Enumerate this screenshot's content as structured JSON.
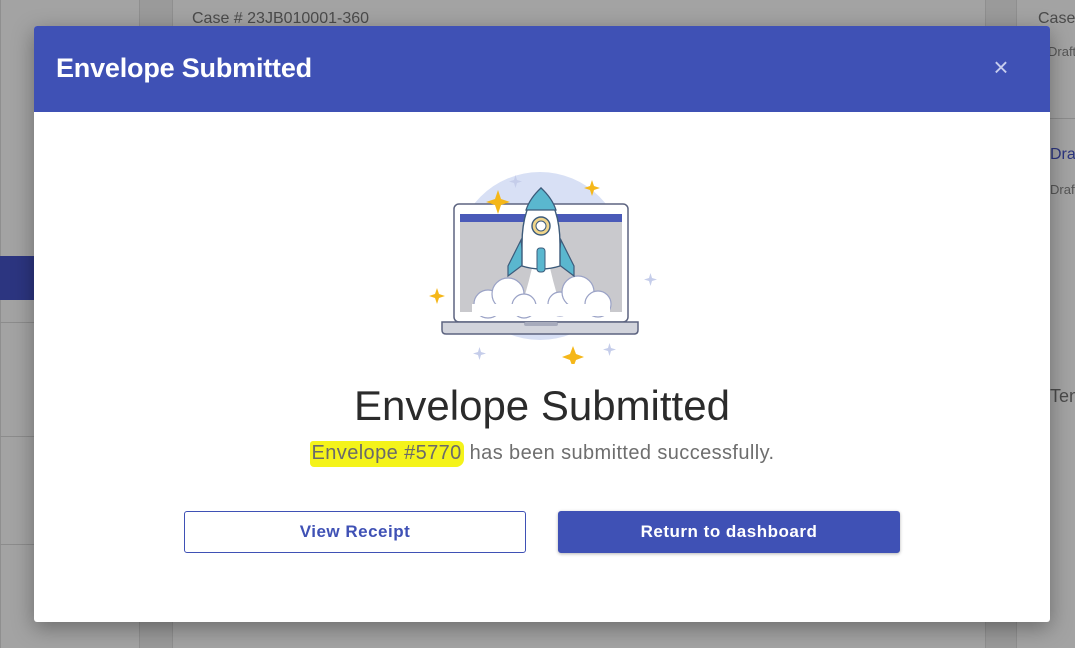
{
  "background": {
    "case_number": "Case # 23JB010001-360",
    "right_case": "Case",
    "right_draft_1": "Draft",
    "right_draft_2": "Draft",
    "right_draft_3": "Draft",
    "right_fragment": "Ten"
  },
  "modal": {
    "title": "Envelope Submitted",
    "close_symbol": "×",
    "illustration_icon": "rocket-launch-laptop",
    "headline": "Envelope Submitted",
    "envelope_label": "Envelope #5770",
    "message_suffix": " has been submitted successfully.",
    "view_receipt_label": "View Receipt",
    "return_dashboard_label": "Return to dashboard"
  },
  "colors": {
    "primary": "#3f51b5",
    "highlight": "#f4f31a",
    "overlay": "#9a9a9a"
  }
}
